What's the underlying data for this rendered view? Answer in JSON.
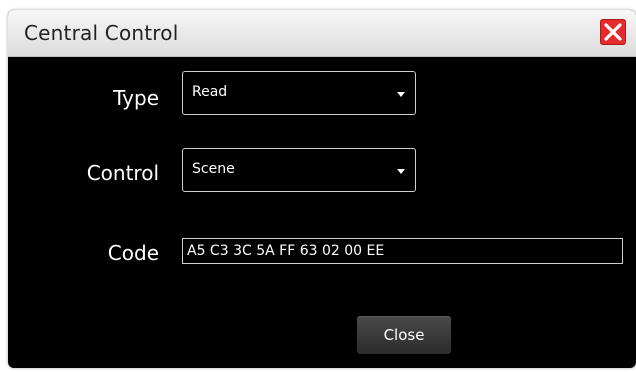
{
  "window": {
    "title": "Central Control",
    "close_icon": "close-x-icon",
    "accent_close_color": "#e52b2b"
  },
  "form": {
    "type_label": "Type",
    "type_value": "Read",
    "control_label": "Control",
    "control_value": "Scene",
    "code_label": "Code",
    "code_value": "A5 C3 3C 5A FF 63 02 00 EE"
  },
  "footer": {
    "close_label": "Close"
  }
}
